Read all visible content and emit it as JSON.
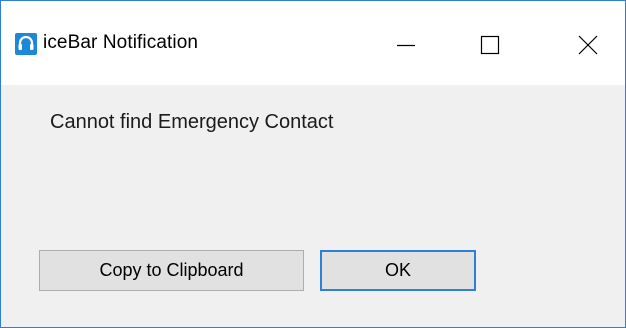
{
  "window": {
    "title": "iceBar Notification",
    "accent_color": "#2f7fd6",
    "app_icon": "headset-icon",
    "controls": [
      "minimize-icon",
      "maximize-icon",
      "close-icon"
    ]
  },
  "dialog": {
    "message": "Cannot find Emergency Contact",
    "buttons": {
      "copy_label": "Copy to Clipboard",
      "ok_label": "OK"
    }
  }
}
